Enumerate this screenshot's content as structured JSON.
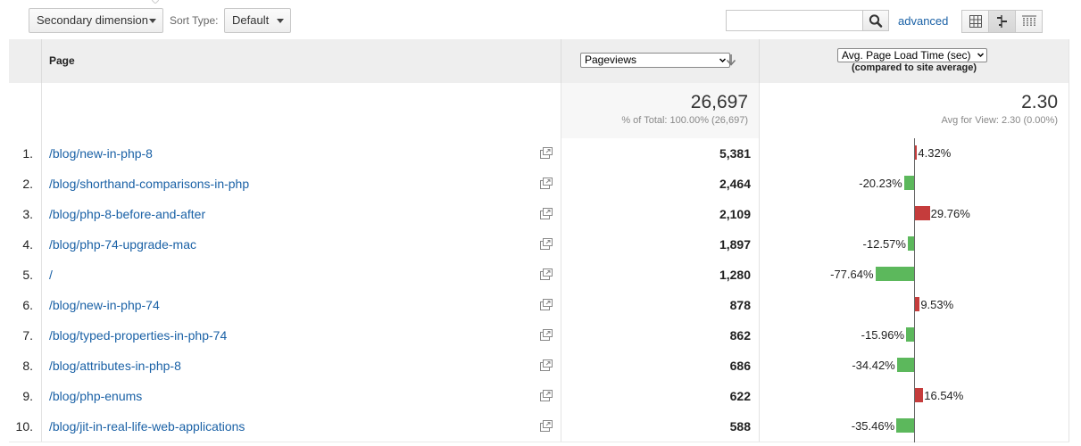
{
  "toolbar": {
    "secondary_dimension_label": "Secondary dimension",
    "sort_type_label": "Sort Type:",
    "sort_type_value": "Default",
    "search_placeholder": "",
    "advanced_label": "advanced",
    "views": [
      "data-table-icon",
      "comparison-view-icon",
      "term-cloud-icon"
    ]
  },
  "table": {
    "columns": {
      "page": "Page",
      "metric": "Pageviews",
      "comparison_metric": "Avg. Page Load Time (sec)",
      "comparison_note": "(compared to site average)"
    },
    "totals": {
      "pageviews": "26,697",
      "pageviews_share": "% of Total: 100.00% (26,697)",
      "avg_load": "2.30",
      "avg_load_note": "Avg for View: 2.30 (0.00%)"
    },
    "rows": [
      {
        "index": "1.",
        "page": "/blog/new-in-php-8",
        "pageviews": "5,381",
        "diff": 4.32,
        "diff_label": "4.32%"
      },
      {
        "index": "2.",
        "page": "/blog/shorthand-comparisons-in-php",
        "pageviews": "2,464",
        "diff": -20.23,
        "diff_label": "-20.23%"
      },
      {
        "index": "3.",
        "page": "/blog/php-8-before-and-after",
        "pageviews": "2,109",
        "diff": 29.76,
        "diff_label": "29.76%"
      },
      {
        "index": "4.",
        "page": "/blog/php-74-upgrade-mac",
        "pageviews": "1,897",
        "diff": -12.57,
        "diff_label": "-12.57%"
      },
      {
        "index": "5.",
        "page": "/",
        "pageviews": "1,280",
        "diff": -77.64,
        "diff_label": "-77.64%"
      },
      {
        "index": "6.",
        "page": "/blog/new-in-php-74",
        "pageviews": "878",
        "diff": 9.53,
        "diff_label": "9.53%"
      },
      {
        "index": "7.",
        "page": "/blog/typed-properties-in-php-74",
        "pageviews": "862",
        "diff": -15.96,
        "diff_label": "-15.96%"
      },
      {
        "index": "8.",
        "page": "/blog/attributes-in-php-8",
        "pageviews": "686",
        "diff": -34.42,
        "diff_label": "-34.42%"
      },
      {
        "index": "9.",
        "page": "/blog/php-enums",
        "pageviews": "622",
        "diff": 16.54,
        "diff_label": "16.54%"
      },
      {
        "index": "10.",
        "page": "/blog/jit-in-real-life-web-applications",
        "pageviews": "588",
        "diff": -35.46,
        "diff_label": "-35.46%"
      }
    ]
  },
  "colors": {
    "link": "#1a61a6",
    "above_average": "#c53c3c",
    "below_average": "#5cb85c"
  }
}
